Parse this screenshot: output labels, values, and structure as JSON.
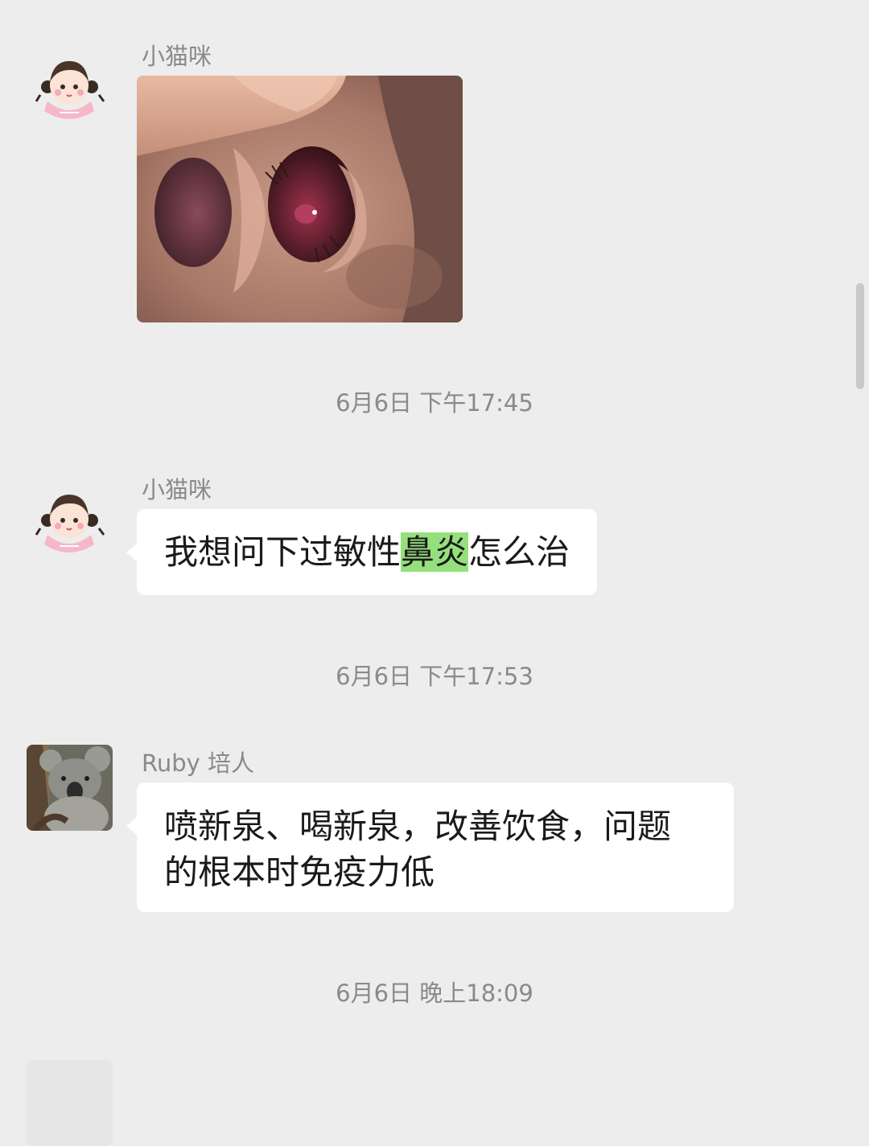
{
  "chat": {
    "messages": [
      {
        "sender": "小猫咪",
        "avatar_icon": "cartoon-girl-avatar",
        "kind": "image",
        "image_desc_icon": "nostril-closeup-photo"
      },
      {
        "kind": "timestamp",
        "text": "6月6日 下午17:45"
      },
      {
        "sender": "小猫咪",
        "avatar_icon": "cartoon-girl-avatar",
        "kind": "text",
        "text_before": "我想问下过敏性",
        "text_highlight": "鼻炎",
        "text_after": "怎么治",
        "highlight_color": "#95e07d"
      },
      {
        "kind": "timestamp",
        "text": "6月6日 下午17:53"
      },
      {
        "sender": "Ruby 培人",
        "avatar_icon": "koala-photo-avatar",
        "kind": "text",
        "line1": "喷新泉、喝新泉，改善饮食，问题",
        "line2": "的根本时免疫力低"
      },
      {
        "kind": "timestamp",
        "text": "6月6日 晚上18:09"
      }
    ]
  },
  "colors": {
    "background": "#ededed",
    "bubble": "#ffffff",
    "meta_text": "#8a8a8a",
    "highlight": "#95e07d"
  }
}
